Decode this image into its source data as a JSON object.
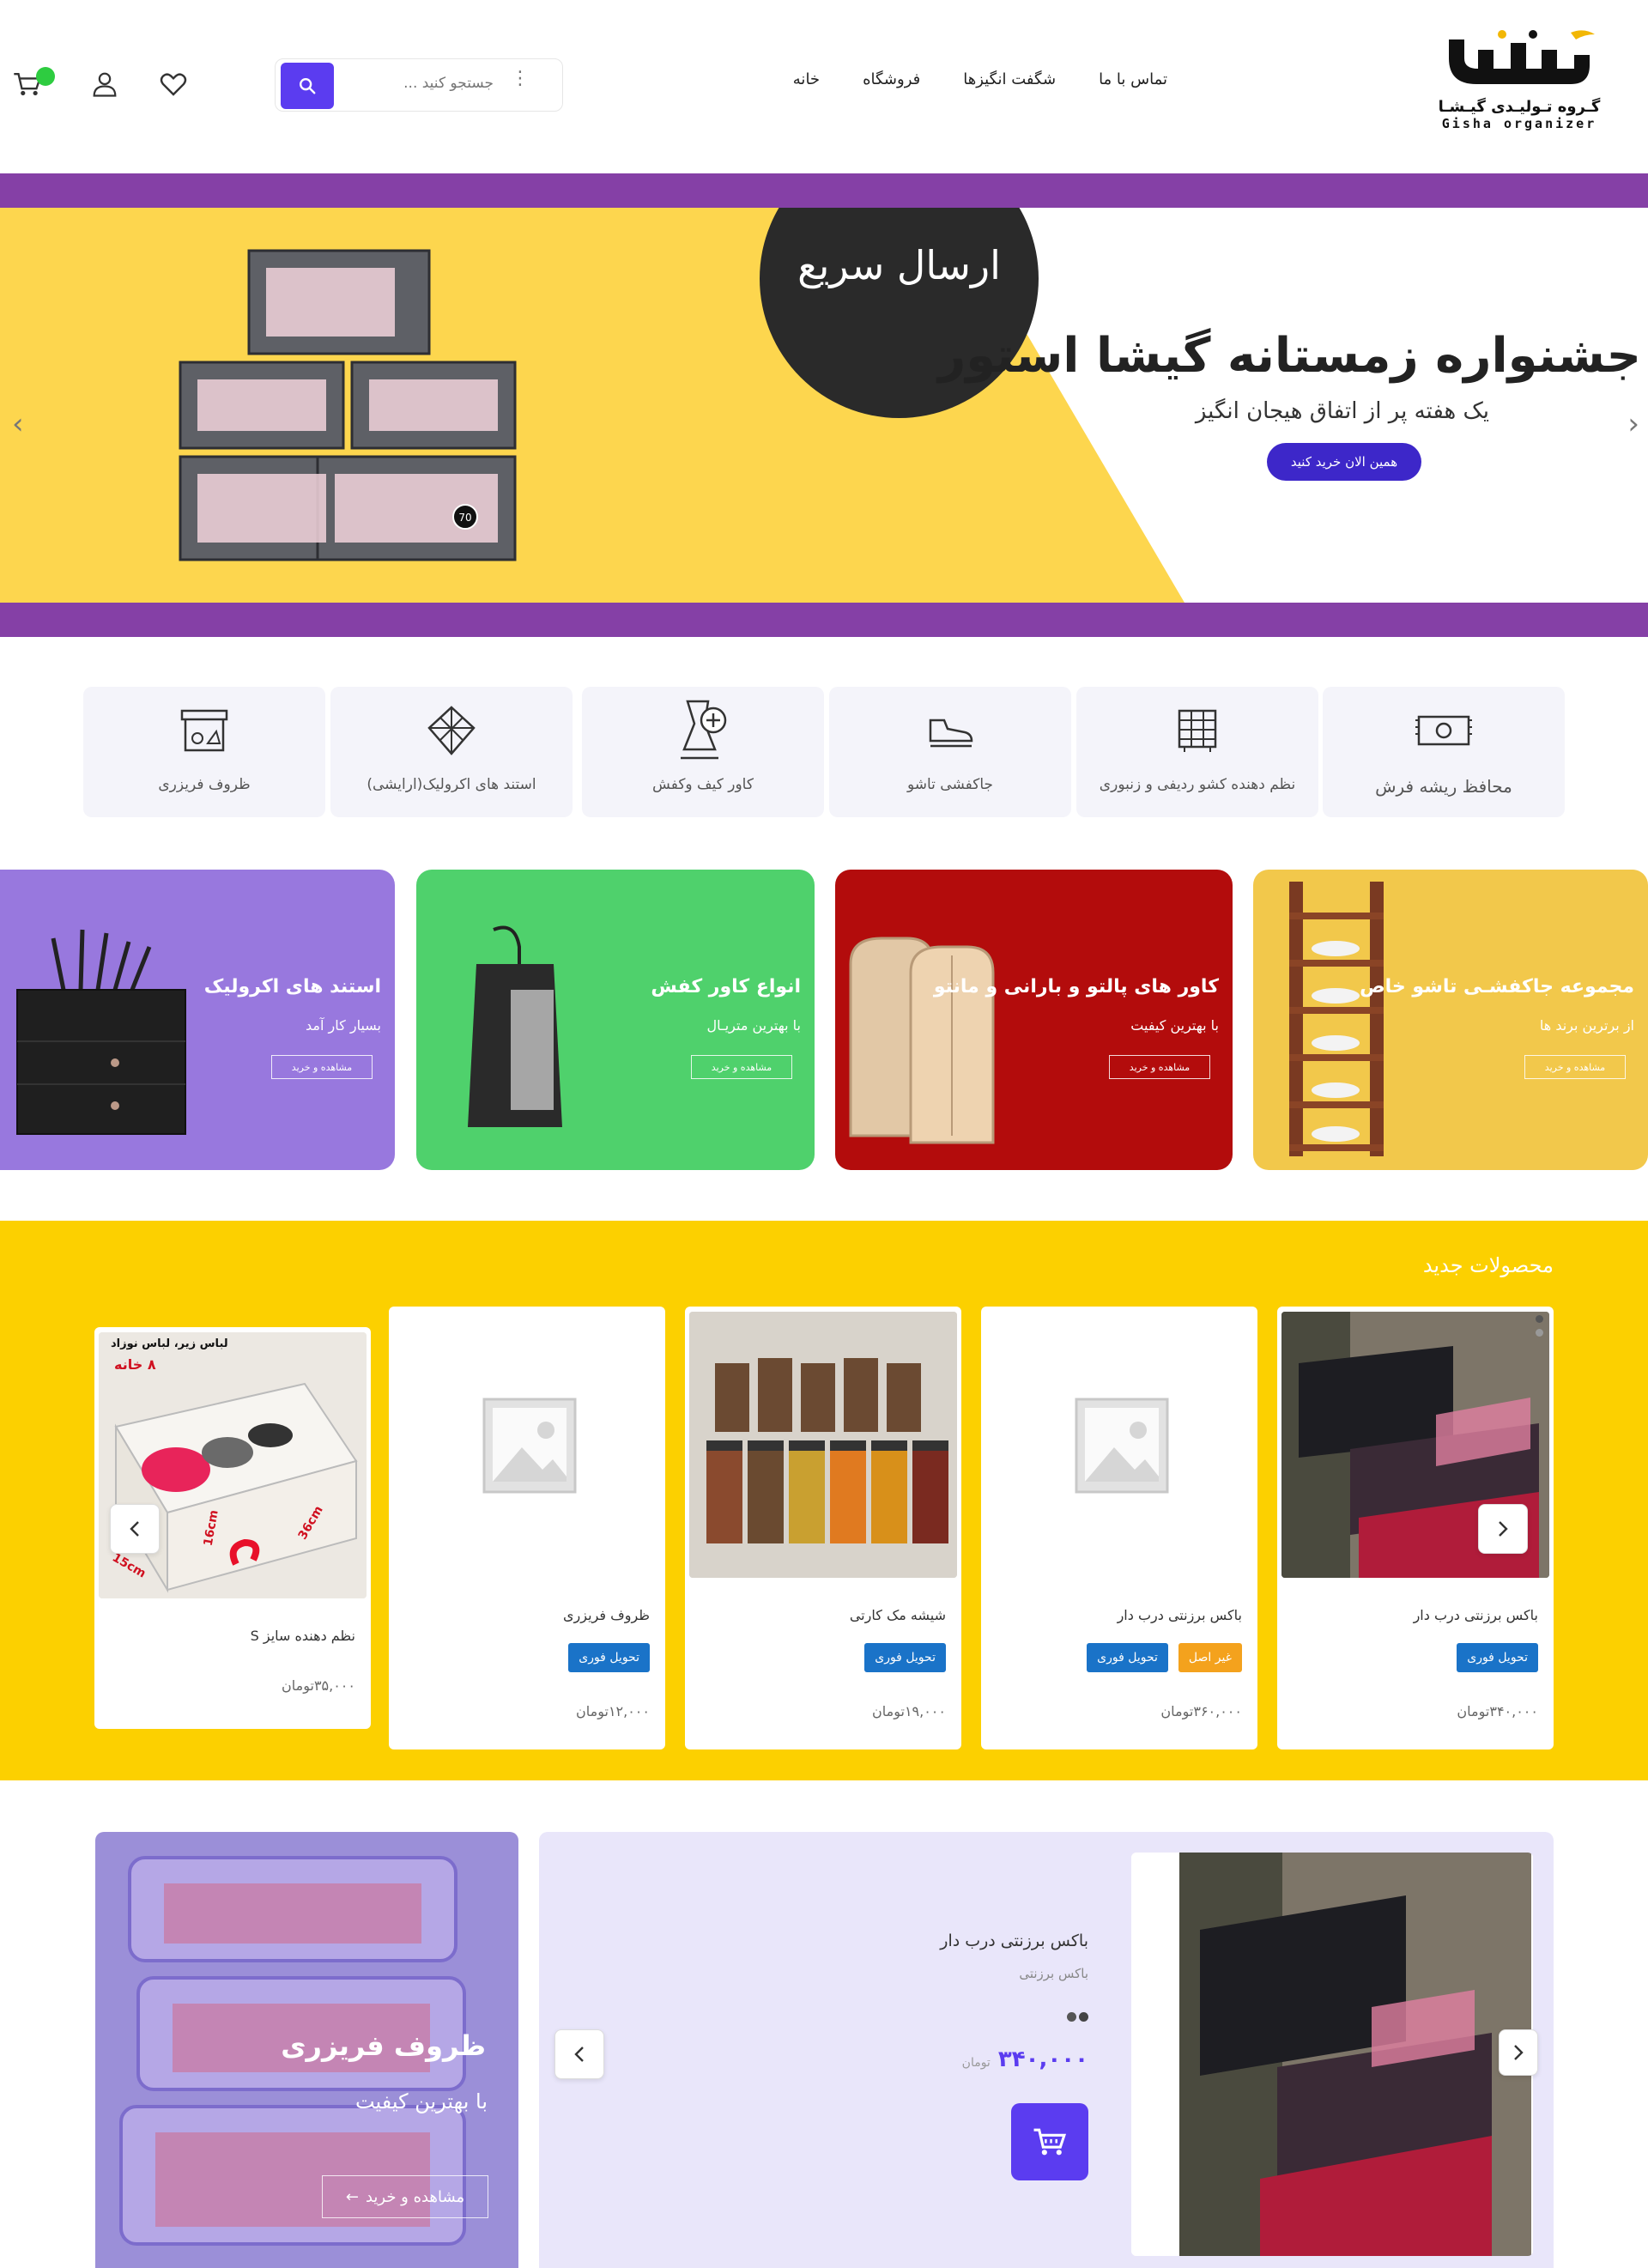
{
  "brand": {
    "logo_text": "گیشا",
    "subtitle_fa": "گـروه تـولیـدی گیـشـا",
    "subtitle_en": "Gisha organizer",
    "accent": "#5b3cf0",
    "cart_dot": "#2ecc40"
  },
  "nav": {
    "items": [
      {
        "label": "خانه"
      },
      {
        "label": "فروشگاه"
      },
      {
        "label": "شگفت انگیزها"
      },
      {
        "label": "تماس با ما"
      }
    ]
  },
  "search": {
    "placeholder": "جستجو کنید ...",
    "value": ""
  },
  "hero": {
    "title": "جشنواره زمستانه گیشا استور",
    "subtitle": "یک هفته پر از اتفاق هیجان انگیز",
    "button": "همین الان خرید کنید",
    "badge": "ارسال سریع",
    "colors": {
      "yellow": "#fdd64e",
      "purple": "#8540a6"
    }
  },
  "categories": [
    {
      "label": "محافظ ریشه فرش",
      "icon": "rug-icon"
    },
    {
      "label": "نظم دهنده کشو ردیفی و زنبوری",
      "icon": "drawer-organizer-icon"
    },
    {
      "label": "جاکفشی تاشو",
      "icon": "shoe-icon"
    },
    {
      "label": "کاور کیف وکفش",
      "icon": "bag-cover-icon"
    },
    {
      "label": "استند های اکرولیک(ارایشی)",
      "icon": "acrylic-stand-icon"
    },
    {
      "label": "ظروف فریزری",
      "icon": "freezer-box-icon"
    }
  ],
  "promos": [
    {
      "title": "مجموعه جاکفشـی تاشو خاص",
      "subtitle": "از برترین برند ها",
      "button": "مشاهده و خرید",
      "color": "#f2c84b"
    },
    {
      "title": "کاور های پالتو و بارانی و مانتو",
      "subtitle": "با بهترین کیفیت",
      "button": "مشاهده و خرید",
      "color": "#b30c0c"
    },
    {
      "title": "انواع کاور کفش",
      "subtitle": "با بهترین متریـال",
      "button": "مشاهده و خرید",
      "color": "#4fd16c"
    },
    {
      "title": "استند های اکرولیک",
      "subtitle": "بسیار کار آمد",
      "button": "مشاهده و خرید",
      "color": "#9878de"
    }
  ],
  "new_products": {
    "title": "محصولات جدید",
    "items": [
      {
        "name": "باکس برزنتی درب دار",
        "badges": [
          "تحویل فوری"
        ],
        "price": "۳۴۰,۰۰۰تومان"
      },
      {
        "name": "باکس برزنتی درب دار",
        "badges": [
          "غیر اصل",
          "تحویل فوری"
        ],
        "price": "۳۶۰,۰۰۰تومان"
      },
      {
        "name": "شیشه مک کارتی",
        "badges": [
          "تحویل فوری"
        ],
        "price": "۱۹,۰۰۰تومان"
      },
      {
        "name": "ظروف فریزری",
        "badges": [
          "تحویل فوری"
        ],
        "price": "۱۲,۰۰۰تومان"
      },
      {
        "name": "نظم دهنده سایز S",
        "badges": [],
        "price": "۳۵,۰۰۰تومان"
      }
    ],
    "card5_overlay": {
      "line1": "لباس زیر، لباس نوزاد",
      "line2": "۸ خانه",
      "dim1": "36cm",
      "dim2": "16cm",
      "dim3": "15cm"
    },
    "jar_badge": "70"
  },
  "freezer_banner": {
    "title": "ظروف فریزری",
    "subtitle": "با بهترین کیفیت",
    "button": "مشاهده و خرید"
  },
  "featured": {
    "name": "باکس برزنتی درب دار",
    "category": "باکس برزنتی",
    "price": "۳۴۰,۰۰۰",
    "currency": "تومان"
  }
}
